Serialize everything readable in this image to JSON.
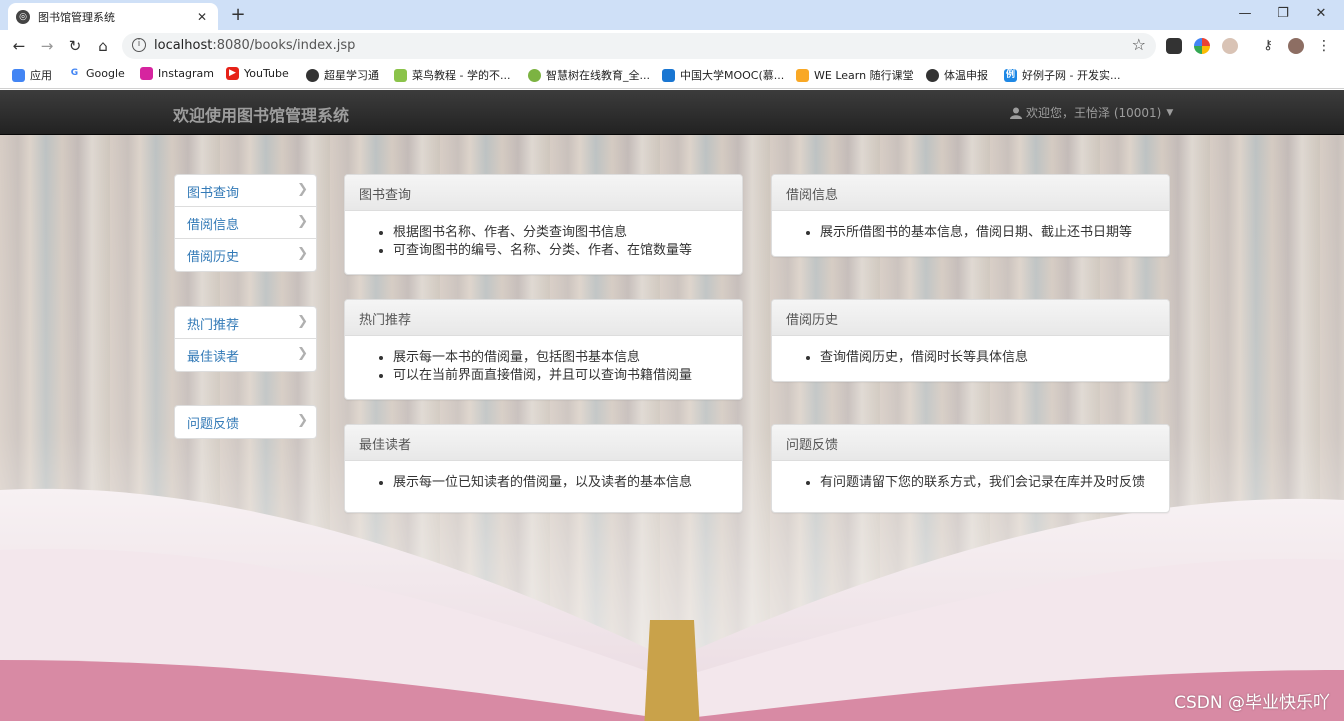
{
  "browser": {
    "tab_title": "图书馆管理系统",
    "url_host": "localhost",
    "url_path": ":8080/books/index.jsp",
    "bookmarks": [
      "应用",
      "Google",
      "Instagram",
      "YouTube",
      "超星学习通",
      "菜鸟教程 - 学的不...",
      "智慧树在线教育_全...",
      "中国大学MOOC(慕...",
      "WE Learn 随行课堂",
      "体温申报",
      "好例子网 - 开发实..."
    ]
  },
  "navbar": {
    "brand": "欢迎使用图书馆管理系统",
    "user": "欢迎您，王怡泽 (10001)"
  },
  "sidebar": {
    "group1": [
      "图书查询",
      "借阅信息",
      "借阅历史"
    ],
    "group2": [
      "热门推荐",
      "最佳读者"
    ],
    "group3": [
      "问题反馈"
    ]
  },
  "panels": {
    "book_search": {
      "title": "图书查询",
      "items": [
        "根据图书名称、作者、分类查询图书信息",
        "可查询图书的编号、名称、分类、作者、在馆数量等"
      ]
    },
    "borrow_info": {
      "title": "借阅信息",
      "items": [
        "展示所借图书的基本信息，借阅日期、截止还书日期等"
      ]
    },
    "hot": {
      "title": "热门推荐",
      "items": [
        "展示每一本书的借阅量，包括图书基本信息",
        "可以在当前界面直接借阅，并且可以查询书籍借阅量"
      ]
    },
    "history": {
      "title": "借阅历史",
      "items": [
        "查询借阅历史，借阅时长等具体信息"
      ]
    },
    "best_readers": {
      "title": "最佳读者",
      "items": [
        "展示每一位已知读者的借阅量，以及读者的基本信息"
      ]
    },
    "feedback": {
      "title": "问题反馈",
      "items": [
        "有问题请留下您的联系方式，我们会记录在库并及时反馈"
      ]
    }
  },
  "watermark": "CSDN @毕业快乐吖"
}
